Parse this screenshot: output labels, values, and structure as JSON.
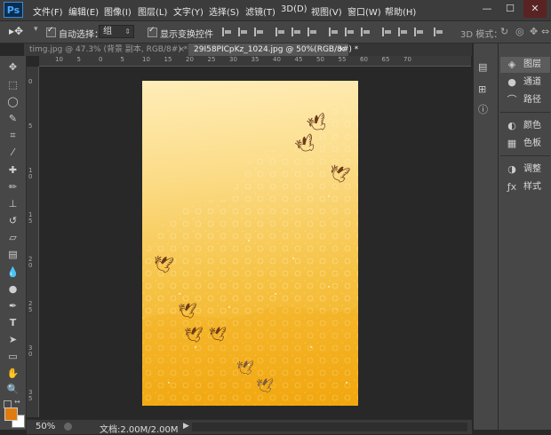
{
  "app": {
    "logo": "Ps"
  },
  "menu": [
    "文件(F)",
    "编辑(E)",
    "图像(I)",
    "图层(L)",
    "文字(Y)",
    "选择(S)",
    "滤镜(T)",
    "3D(D)",
    "视图(V)",
    "窗口(W)",
    "帮助(H)"
  ],
  "window_controls": {
    "minimize": "—",
    "maximize": "☐",
    "close": "✕"
  },
  "options": {
    "auto_select_label": "自动选择：",
    "auto_select_value": "组",
    "transform_controls_label": "显示变换控件",
    "mode_3d_label": "3D 模式："
  },
  "tabs": [
    {
      "title": "timg.jpg @ 47.3% (背景 副本, RGB/8#) *",
      "close": "×",
      "active": false
    },
    {
      "title": "29I58PICpKz_1024.jpg @ 50%(RGB/8#) *",
      "close": "×",
      "active": true
    }
  ],
  "ruler_top": [
    "10",
    "5",
    "0",
    "5",
    "10",
    "15",
    "20",
    "25",
    "30",
    "35",
    "40",
    "45",
    "50",
    "55",
    "60",
    "65",
    "70"
  ],
  "ruler_left": [
    "0",
    "5",
    "1 0",
    "1 5",
    "2 0",
    "2 5",
    "3 0",
    "3 5"
  ],
  "status": {
    "zoom": "50%",
    "doc_info": "文档:2.00M/2.00M"
  },
  "panels_group1": [
    {
      "icon": "layers-icon",
      "glyph": "◈",
      "label": "图层",
      "active": true
    },
    {
      "icon": "channels-icon",
      "glyph": "●",
      "label": "通道",
      "active": false
    },
    {
      "icon": "paths-icon",
      "glyph": "⌒",
      "label": "路径",
      "active": false
    }
  ],
  "panels_group2": [
    {
      "icon": "color-icon",
      "glyph": "◐",
      "label": "颜色",
      "active": false
    },
    {
      "icon": "swatches-icon",
      "glyph": "▦",
      "label": "色板",
      "active": false
    }
  ],
  "panels_group3": [
    {
      "icon": "adjustments-icon",
      "glyph": "◑",
      "label": "调整",
      "active": false
    },
    {
      "icon": "styles-icon",
      "glyph": "ƒx",
      "label": "样式",
      "active": false
    }
  ],
  "colors": {
    "foreground": "#e07b0e",
    "background": "#ffffff",
    "accent": "#4ca6ff"
  }
}
